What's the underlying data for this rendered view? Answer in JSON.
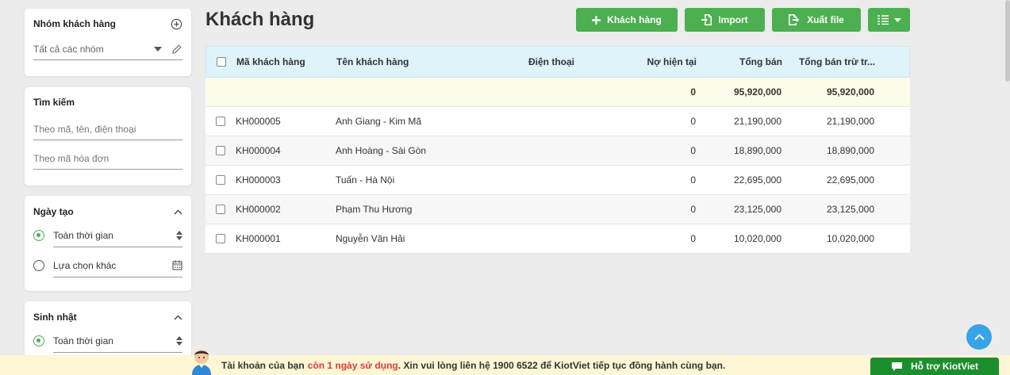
{
  "sidebar": {
    "group": {
      "title": "Nhóm khách hàng",
      "value": "Tất cả các nhóm"
    },
    "search": {
      "title": "Tìm kiếm",
      "placeholder_main": "Theo mã, tên, điện thoại",
      "placeholder_invoice": "Theo mã hóa đơn"
    },
    "created_date": {
      "title": "Ngày tạo",
      "option_all": "Toàn thời gian",
      "option_custom": "Lựa chọn khác"
    },
    "birthday": {
      "title": "Sinh nhật",
      "option_all": "Toàn thời gian"
    }
  },
  "header": {
    "title": "Khách hàng",
    "add_label": "Khách hàng",
    "import_label": "Import",
    "export_label": "Xuất file"
  },
  "table": {
    "columns": {
      "code": "Mã khách hàng",
      "name": "Tên khách hàng",
      "phone": "Điện thoại",
      "debt": "Nợ hiện tại",
      "sales": "Tổng bán",
      "net": "Tổng bán trừ tr..."
    },
    "summary": {
      "debt": "0",
      "sales": "95,920,000",
      "net": "95,920,000"
    },
    "rows": [
      {
        "code": "KH000005",
        "name": "Anh Giang - Kim Mã",
        "phone": "",
        "debt": "0",
        "sales": "21,190,000",
        "net": "21,190,000"
      },
      {
        "code": "KH000004",
        "name": "Anh Hoàng - Sài Gòn",
        "phone": "",
        "debt": "0",
        "sales": "18,890,000",
        "net": "18,890,000"
      },
      {
        "code": "KH000003",
        "name": "Tuấn - Hà Nội",
        "phone": "",
        "debt": "0",
        "sales": "22,695,000",
        "net": "22,695,000"
      },
      {
        "code": "KH000002",
        "name": "Phạm Thu Hương",
        "phone": "",
        "debt": "0",
        "sales": "23,125,000",
        "net": "23,125,000"
      },
      {
        "code": "KH000001",
        "name": "Nguyễn Văn Hải",
        "phone": "",
        "debt": "0",
        "sales": "10,020,000",
        "net": "10,020,000"
      }
    ]
  },
  "banner": {
    "text_before": "Tài khoản của bạn",
    "highlight": "còn 1 ngày sử dụng",
    "text_after": ". Xin vui lòng liên hệ 1900 6522 để KiotViet tiếp tục đồng hành cùng bạn."
  },
  "support": {
    "label": "Hỗ trợ KiotViet"
  },
  "colors": {
    "primary_green": "#4caf50",
    "header_blue": "#dff3fb",
    "highlight_red": "#e53935",
    "scroll_blue": "#37a3e8"
  },
  "icons": [
    "plus-circle-icon",
    "pencil-icon",
    "caret-down-icon",
    "chevron-up-icon",
    "sort-icon",
    "calendar-icon",
    "plus-icon",
    "import-icon",
    "export-icon",
    "list-view-icon",
    "chat-icon",
    "arrow-up-icon"
  ]
}
